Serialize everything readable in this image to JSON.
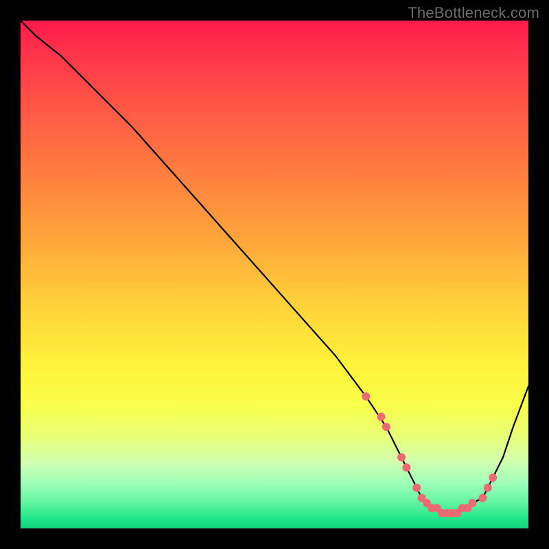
{
  "attribution": "TheBottleneck.com",
  "colors": {
    "background": "#000000",
    "gradient_top": "#ff1a4a",
    "gradient_mid": "#fff33a",
    "gradient_bottom": "#14d47e",
    "line": "#000000",
    "marker": "#ed6a72"
  },
  "chart_data": {
    "type": "line",
    "title": "",
    "xlabel": "",
    "ylabel": "",
    "xlim": [
      0,
      100
    ],
    "ylim": [
      0,
      100
    ],
    "x": [
      0,
      3,
      8,
      14,
      22,
      30,
      38,
      46,
      54,
      62,
      68,
      70,
      72,
      74,
      76,
      78,
      79,
      80,
      81,
      82,
      83,
      84,
      85,
      86,
      87,
      88,
      89,
      91,
      92,
      93,
      95,
      97,
      100
    ],
    "values": [
      100,
      97,
      93,
      87,
      79,
      70,
      61,
      52,
      43,
      34,
      26,
      23,
      20,
      16,
      12,
      8,
      6,
      5,
      4,
      4,
      3,
      3,
      3,
      3,
      4,
      4,
      5,
      6,
      8,
      10,
      14,
      20,
      28
    ],
    "markers": {
      "x": [
        68,
        71,
        72,
        75,
        76,
        78,
        79,
        80,
        81,
        82,
        83,
        84,
        85,
        86,
        87,
        88,
        89,
        91,
        92,
        93
      ],
      "values": [
        26,
        22,
        20,
        14,
        12,
        8,
        6,
        5,
        4,
        4,
        3,
        3,
        3,
        3,
        4,
        4,
        5,
        6,
        8,
        10
      ]
    }
  }
}
